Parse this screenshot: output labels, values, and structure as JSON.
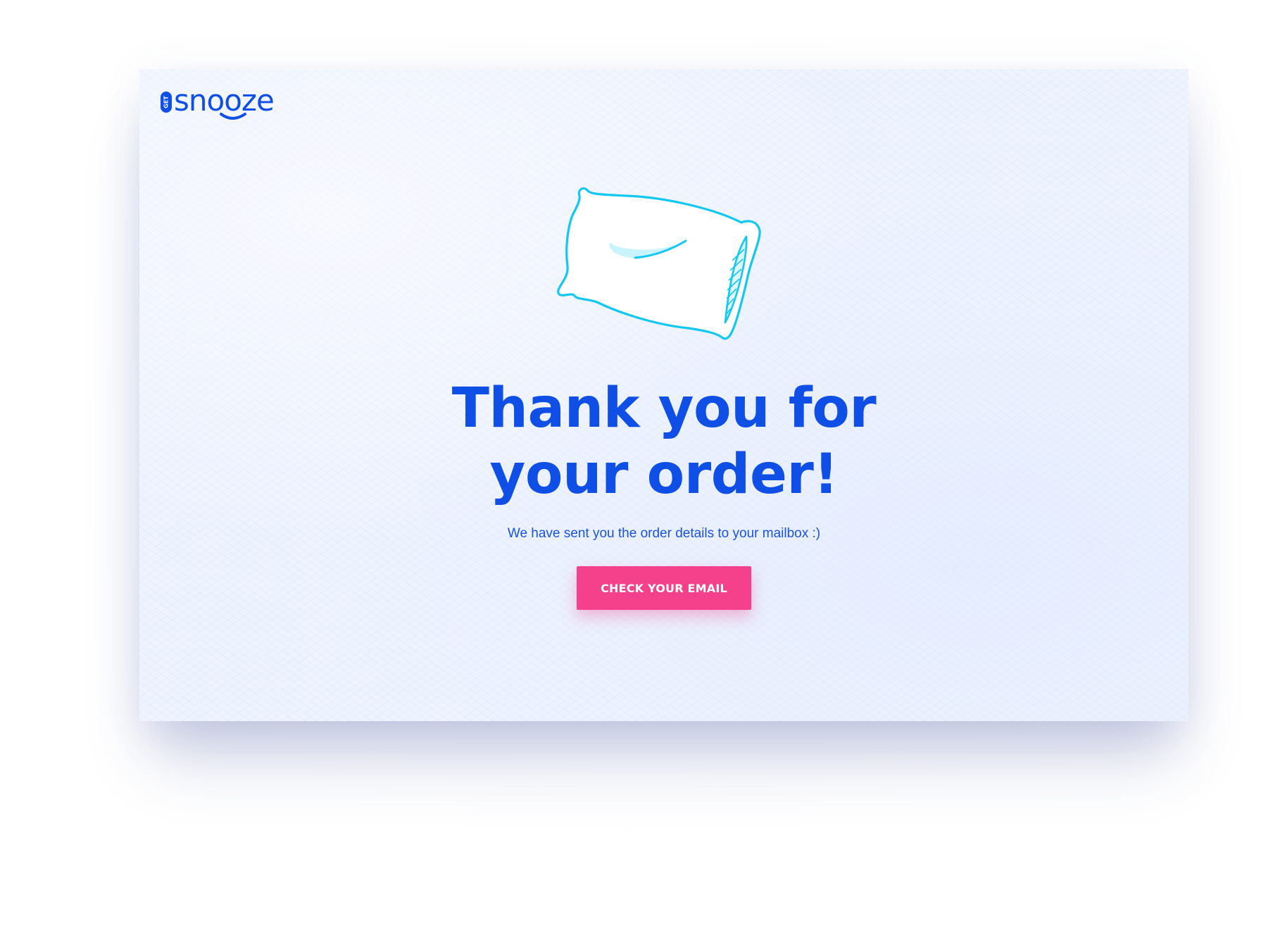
{
  "brand": {
    "name": "snooze",
    "prefix": "GET",
    "color": "#0f4fe6"
  },
  "main": {
    "headline_line1": "Thank you for",
    "headline_line2": "your order!",
    "subtext": "We have sent you the order details to your mailbox :)",
    "cta_label": "CHECK YOUR EMAIL"
  },
  "illustration": {
    "icon": "pillow-icon",
    "stroke_color": "#12c8f0"
  },
  "colors": {
    "accent": "#f5418b",
    "headline": "#0f4fe6",
    "background": "#eef3fe"
  }
}
